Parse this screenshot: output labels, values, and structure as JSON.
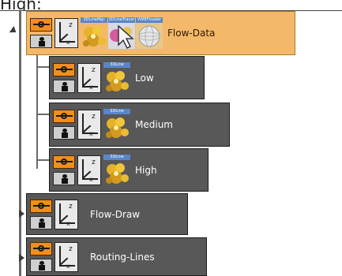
{
  "page_label": "High:",
  "tree": {
    "root": {
      "label": "Flow-Data",
      "selected": true,
      "plugins": [
        {
          "tag": "3DLineMgr",
          "icon": "flower-plugin-icon"
        },
        {
          "tag": "3DLineTracer",
          "icon": "pointer-plugin-icon"
        },
        {
          "tag": "VWBFloader",
          "icon": "sphere-plugin-icon"
        }
      ]
    },
    "children": [
      {
        "label": "Low",
        "plugin_tag": "3DLine"
      },
      {
        "label": "Medium",
        "plugin_tag": "3DLine"
      },
      {
        "label": "High",
        "plugin_tag": "3DLine"
      }
    ],
    "siblings": [
      {
        "label": "Flow-Draw"
      },
      {
        "label": "Routing-Lines"
      }
    ]
  },
  "icons": {
    "visibility": "eye-icon",
    "lock": "lock-icon",
    "transform": "axis-transform-icon",
    "expander": "expand-arrow-icon"
  },
  "colors": {
    "selected_bg": "#f4b86a",
    "node_bg": "#585858",
    "eye_orange": "#f28e1c"
  }
}
